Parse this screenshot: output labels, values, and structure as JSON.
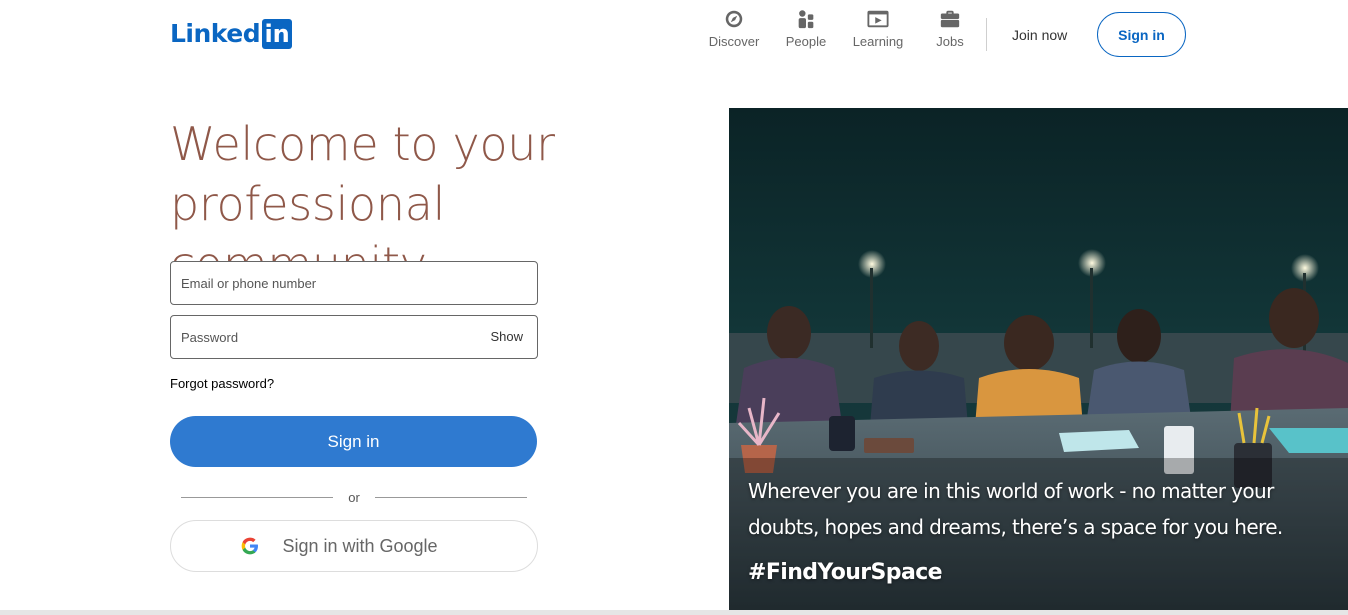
{
  "brand": {
    "logo_text": "Linked",
    "logo_box_text": "in",
    "accent": "#0a66c2"
  },
  "header": {
    "nav": [
      {
        "label": "Discover",
        "icon": "compass-icon"
      },
      {
        "label": "People",
        "icon": "people-icon"
      },
      {
        "label": "Learning",
        "icon": "video-play-icon"
      },
      {
        "label": "Jobs",
        "icon": "briefcase-icon"
      }
    ],
    "join_now": "Join now",
    "sign_in": "Sign in"
  },
  "hero": {
    "headline_line1": "Welcome to your",
    "headline_line2": "professional community",
    "headline_color": "#8f5849"
  },
  "form": {
    "email_placeholder": "Email or phone number",
    "email_value": "",
    "password_placeholder": "Password",
    "password_value": "",
    "show_label": "Show",
    "forgot_password": "Forgot password?",
    "sign_in_button": "Sign in",
    "sign_in_button_color": "#2f7ad0",
    "or_text": "or",
    "google_button": "Sign in with Google",
    "google_icon": "google-g-icon"
  },
  "hero_image": {
    "caption": "Wherever you are in this world of work - no matter your doubts, hopes and dreams, there’s a space for you here.",
    "hashtag": "#FindYourSpace"
  }
}
